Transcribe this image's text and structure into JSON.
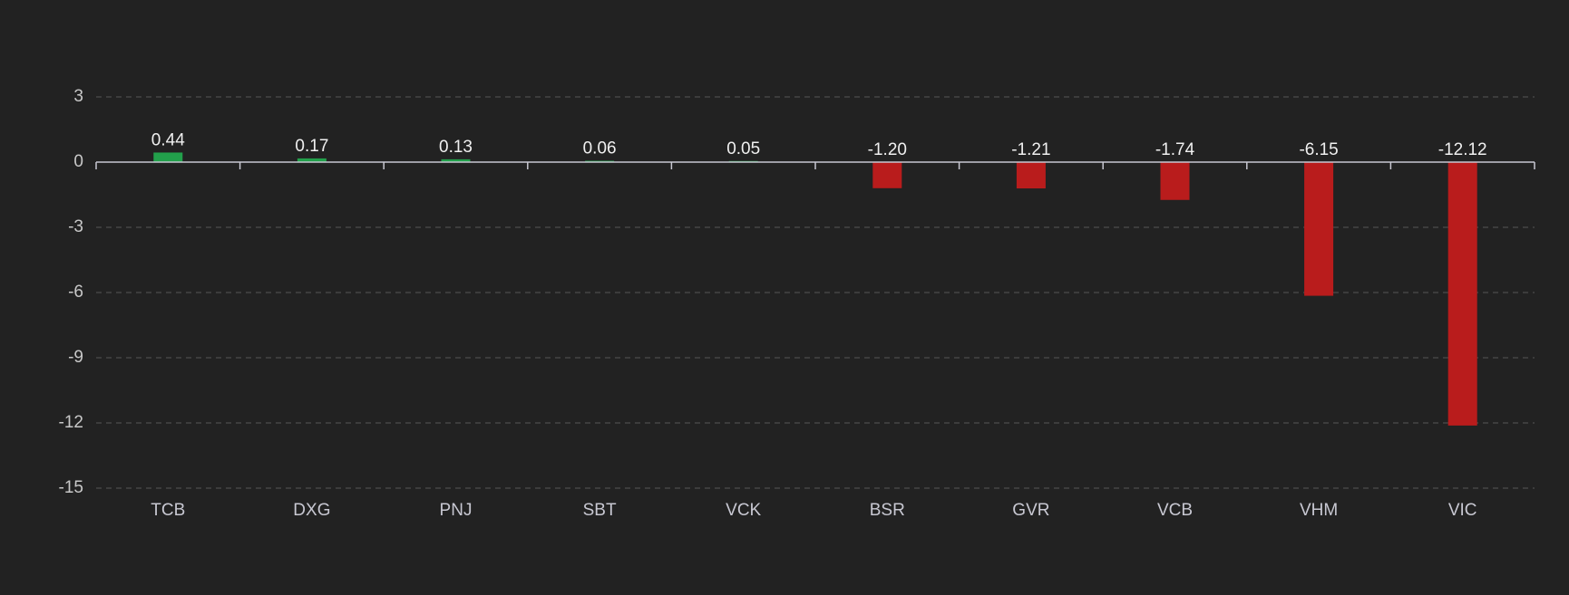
{
  "chart_data": {
    "type": "bar",
    "title": "",
    "xlabel": "",
    "ylabel": "",
    "categories": [
      "TCB",
      "DXG",
      "PNJ",
      "SBT",
      "VCK",
      "BSR",
      "GVR",
      "VCB",
      "VHM",
      "VIC"
    ],
    "values": [
      0.44,
      0.17,
      0.13,
      0.06,
      0.05,
      -1.2,
      -1.21,
      -1.74,
      -6.15,
      -12.12
    ],
    "data_labels": [
      "0.44",
      "0.17",
      "0.13",
      "0.06",
      "0.05",
      "-1.20",
      "-1.21",
      "-1.74",
      "-6.15",
      "-12.12"
    ],
    "ylim": [
      -15,
      3
    ],
    "yticks": [
      3,
      0,
      -3,
      -6,
      -9,
      -12,
      -15
    ],
    "grid": true,
    "legend": "none",
    "colors": {
      "background": "#222222",
      "positive": "#22a04b",
      "negative": "#b91c1c"
    }
  }
}
